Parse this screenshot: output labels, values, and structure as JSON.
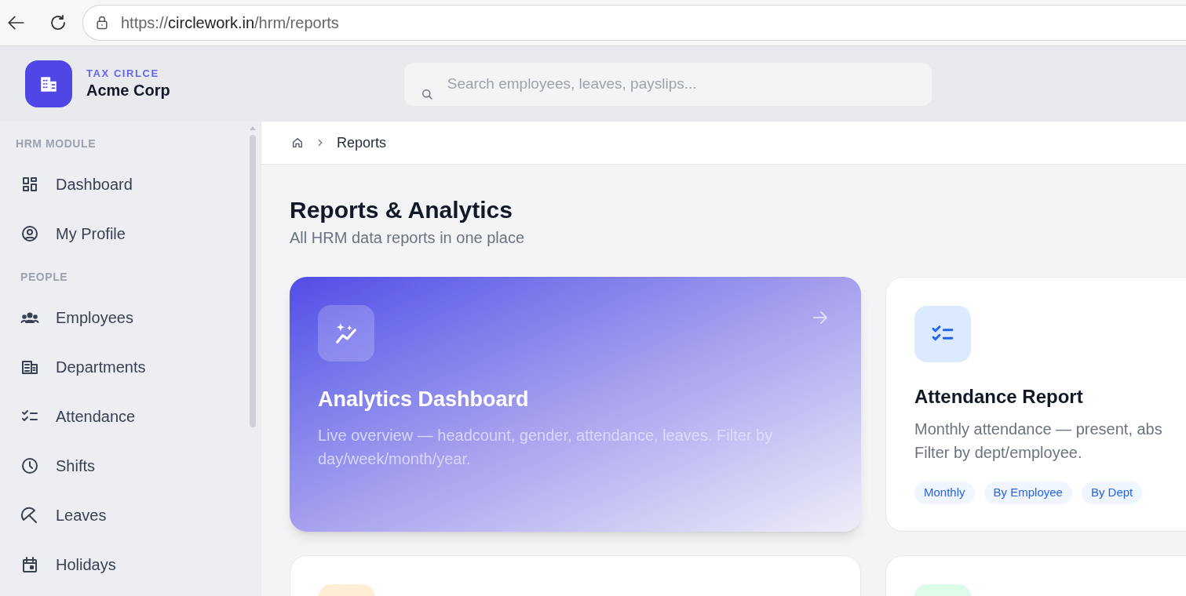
{
  "browser": {
    "url": {
      "scheme": "https://",
      "host": "circlework.in",
      "path": "/hrm/reports"
    }
  },
  "header": {
    "brand": "TAX CIRLCE",
    "company": "Acme Corp",
    "search": {
      "placeholder": "Search employees, leaves, payslips..."
    }
  },
  "sidebar": {
    "sections": [
      {
        "title": "HRM MODULE",
        "items": [
          {
            "label": "Dashboard"
          },
          {
            "label": "My Profile"
          }
        ]
      },
      {
        "title": "PEOPLE",
        "items": [
          {
            "label": "Employees"
          },
          {
            "label": "Departments"
          },
          {
            "label": "Attendance"
          },
          {
            "label": "Shifts"
          },
          {
            "label": "Leaves"
          },
          {
            "label": "Holidays"
          }
        ]
      }
    ]
  },
  "breadcrumb": {
    "current": "Reports"
  },
  "page": {
    "title": "Reports & Analytics",
    "subtitle": "All HRM data reports in one place"
  },
  "cards": [
    {
      "kind": "featured",
      "title": "Analytics Dashboard",
      "description": "Live overview — headcount, gender, attendance, leaves. Filter by day/week/month/year."
    },
    {
      "kind": "plain",
      "color": "#dbeafe",
      "title": "Attendance Report",
      "description_lines": [
        "Monthly attendance — present, abs",
        "Filter by dept/employee."
      ],
      "tags": [
        "Monthly",
        "By Employee",
        "By Dept"
      ]
    },
    {
      "kind": "partial",
      "color": "#ffedd5"
    },
    {
      "kind": "partial",
      "color": "#dcfce7"
    }
  ]
}
